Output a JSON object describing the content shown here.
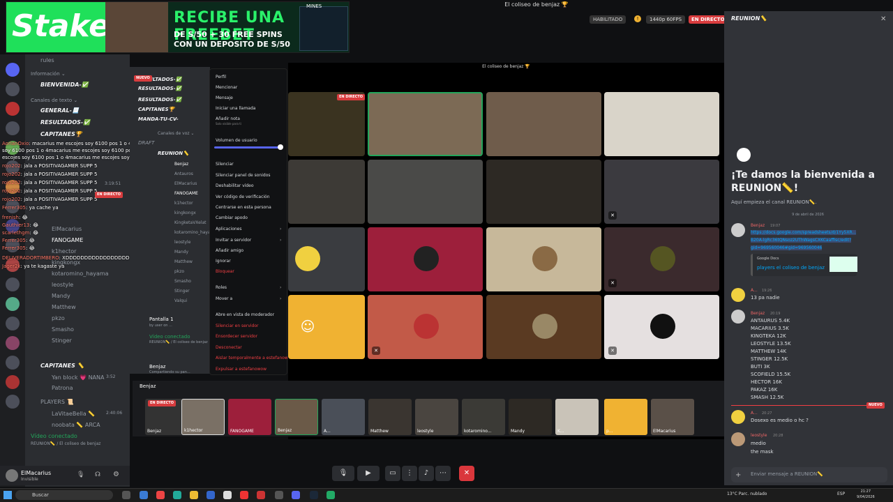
{
  "ad": {
    "brand": "Stake",
    "headline": "RECIBE UNA FREEBET",
    "line1": "DE S/50 + 30 FREE SPINS",
    "line2": "CON UN DEPOSITO DE S/50",
    "game": "MINES"
  },
  "window": {
    "title": "El coliseo de benjaz 🏆"
  },
  "stream": {
    "status": "HABILITADO",
    "resolution": "1440p 60FPS",
    "live": "EN DIRECTO"
  },
  "channels": {
    "rules": "rules",
    "cat_info": "Información ⌄",
    "bienvenida": "BIENVENIDA-✅",
    "cat_text": "Canales de texto ⌄",
    "general": "GENERAL-📃",
    "resultados": "RESULTADOS-✅",
    "capitanes": "CAPITANES🏆",
    "manda": "MANDA-TU-CV-",
    "draft": "DRAFT",
    "cat_voice": "Canales de voz ⌄",
    "reunion": "REUNION📏",
    "members": [
      "Benjaz",
      "Antauros",
      "ElMacarius",
      "FANOGAME",
      "k1hector",
      "kingkongx",
      "KingketaVXelat",
      "kotaromino_hayama",
      "leostyle",
      "Mandy",
      "Matthew",
      "pkzo",
      "Smasho",
      "Stinger",
      "Valqui"
    ],
    "capitanes_vc": "CAPITANES 📏",
    "yan": "Yan block 💗 NANA",
    "patrona": "Patrona",
    "players": "PLAYERS 📜",
    "lavita": "LaVitaeBella 📏",
    "noobata": "noobata 📏 ARCA"
  },
  "chat": [
    {
      "n": "AorianOxio",
      "t": ": macarius me escojes soy 6100 pos 1 o 4macarius me escojes"
    },
    {
      "n": "",
      "t": "soy 6100 pos 1 o 4macarius me escojes soy 6100 pos 1 o 4macarius me"
    },
    {
      "n": "",
      "t": "escojes soy 6100 pos 1 o 4macarius me escojes soy 6100 pos 1 o 4"
    },
    {
      "n": "rojo202",
      "t": ": jala a POSITIVAGAMER SUPP 5"
    },
    {
      "n": "rojo202",
      "t": ": jala a POSITIVAGAMER SUPP 5"
    },
    {
      "n": "rojo202",
      "t": ": jala a POSITIVAGAMER SUPP 5"
    },
    {
      "n": "rojo202",
      "t": ": jala a POSITIVAGAMER SUPP 5"
    },
    {
      "n": "rojo202",
      "t": ": jala a POSITIVAGAMER SUPP 5"
    },
    {
      "n": "Ferrer305",
      "t": ": ya cache ya"
    },
    {
      "n": "frenish",
      "t": ": 😂"
    },
    {
      "n": "Gauthier13",
      "t": ": 😂"
    },
    {
      "n": "scarlethgm",
      "t": ": 😂"
    },
    {
      "n": "Ferrer305",
      "t": ": 😂"
    },
    {
      "n": "Ferrer305",
      "t": ": 😂"
    },
    {
      "n": "DELIVERADORTIMBERO",
      "t": ": XDDDDDDDDDDDDDDDDDDDDDDDDDDDDDDDD"
    },
    {
      "n": "Jager2k",
      "t": ": ya te kagaste ya"
    }
  ],
  "voice": {
    "screen": "Pantalla 1",
    "screen_sub": "by user on ...",
    "connected": "Vídeo conectado",
    "connected_sub": "REUNION📏 / El coliseo de benjaz",
    "user": "Benjaz",
    "user_sub": "Compartiendo su pan...",
    "live": "EN DIRECTO",
    "nuevo": "NUEVO",
    "time": "3:19:51",
    "time2": "3:52",
    "time3": "2:40:06"
  },
  "menu": {
    "items": [
      "Perfil",
      "Mencionar",
      "Mensaje",
      "Iniciar una llamada",
      "Añadir nota"
    ],
    "note_sub": "Solo visible para ti",
    "volume": "Volumen de usuario",
    "items2": [
      "Silenciar",
      "Silenciar panel de sonidos",
      "Deshabilitar vídeo",
      "Ver código de verificación",
      "Centrarse en esta persona",
      "Cambiar apodo"
    ],
    "apps": "Aplicaciones",
    "invite": "Invitar a servidor",
    "add": "Añadir amigo",
    "ignore": "Ignorar",
    "block": "Bloquear",
    "roles": "Roles",
    "move": "Mover a",
    "mod": "Abre en vista de moderador",
    "red": [
      "Silenciar en servidor",
      "Ensordecer servidor",
      "Desconectar",
      "Aislar temporalmente a estefanowow",
      "Expulsar a estefanowow"
    ]
  },
  "strip": {
    "user": "Benjaz",
    "live": "EN DIRECTO",
    "thumbs": [
      "Benjaz",
      "k1hector",
      "FANOGAME",
      "Benjaz",
      "A...",
      "Matthew",
      "leostyle",
      "kotaromino...",
      "Mandy",
      "K...",
      "p...",
      "ElMacarius"
    ]
  },
  "right": {
    "title": "REUNION📏",
    "welcome": "¡Te damos la bienvenida a REUNION📏!",
    "welcome_sub": "Aquí empieza el canal REUNION📏.",
    "date": "9 de abril de 2026",
    "m1_name": "Benjaz",
    "m1_time": "19:07",
    "m1_link": [
      "https://docs.google.com/spreadsheets/d/1Yy5XR...",
      "B20A-lgRc36tQNsoz2UThWagsCXKCaaffisc/edit?",
      "gid=969560046#gid=969560046"
    ],
    "embed_src": "Google Docs",
    "embed_title": "players el coliseo de benjaz",
    "m2_name": "A...",
    "m2_time": "19:26",
    "m2_text": "13 pa nadie",
    "m3_name": "Benjaz",
    "m3_time": "20:19",
    "m3_lines": [
      "ANTAURUS 5.4K",
      "MACARIUS 3.5K",
      "KINGTEKA 12K",
      "LEOSTYLE 13.5K",
      "MATTHEW 14K",
      "STINGER 12.5K",
      "BUTI 3K",
      "SCOFIELD 15.5K",
      "HECTOR 16K",
      "PAKAZ 16K",
      "SMASH 12.5K"
    ],
    "nuevo": "NUEVO",
    "m4_name": "A...",
    "m4_time": "20:27",
    "m4_text": "Dosexo es medio o hc ?",
    "m5_name": "leostyle",
    "m5_time": "20:28",
    "m5_lines": [
      "medio",
      "the mask"
    ],
    "input_placeholder": "Enviar mensaje a REUNION📏"
  },
  "userpanel": {
    "name": "ElMacarius",
    "status": "Invisible"
  },
  "taskbar": {
    "search": "Buscar",
    "weather": "13°C Parc. nublado",
    "lang": "ESP",
    "time": "21:27",
    "date": "9/04/2026"
  },
  "colors": {
    "accent": "#5865f2",
    "danger": "#da373c",
    "live": "#d83c3e",
    "stake": "#1fe05a"
  }
}
